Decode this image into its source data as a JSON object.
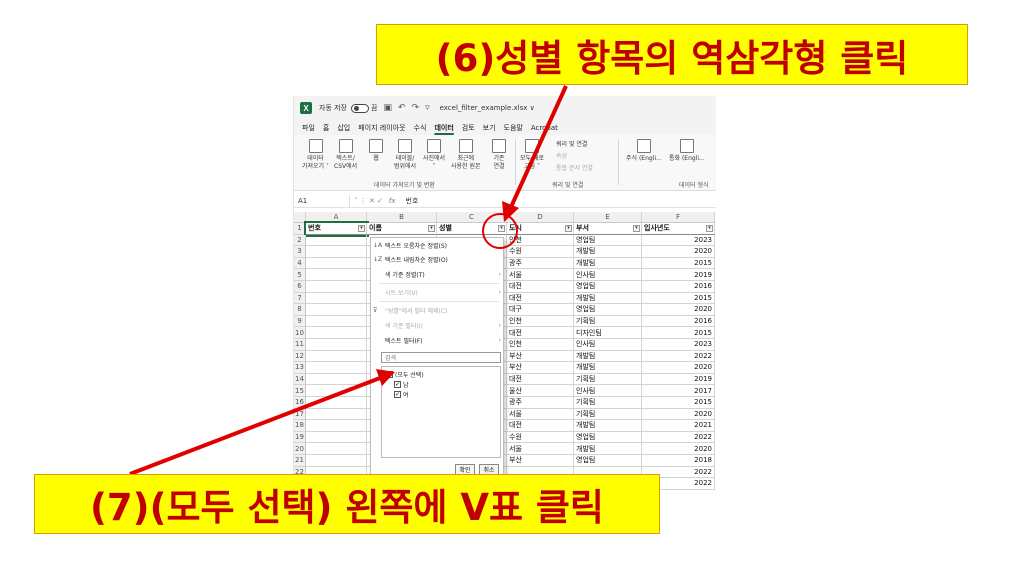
{
  "titlebar": {
    "logo": "X",
    "autosave_label": "자동 저장",
    "toggle_state": "끔",
    "file_name": "excel_filter_example.xlsx ∨"
  },
  "menu": [
    "파일",
    "홈",
    "삽입",
    "페이지 레이아웃",
    "수식",
    "데이터",
    "검토",
    "보기",
    "도움말",
    "Acrobat"
  ],
  "menu_active": "데이터",
  "ribbon": {
    "btn_data_get": "데이터\n가져오기 ˅",
    "btn_text_csv": "텍스트/\nCSV에서",
    "btn_web": "웹",
    "btn_table_range": "테이블/\n범위에서",
    "btn_from_picture": "사진에서\n˅",
    "btn_recent": "최근에\n사용한 원본",
    "btn_existing": "기존\n연결",
    "btn_refresh_all": "모두 새로\n고침 ˅",
    "group_get_transform": "데이터 가져오기 및 변환",
    "query_connections": "쿼리 및 연결",
    "properties": "속성",
    "edit_links": "통합 문서 연결",
    "group_queries": "쿼리 및 연결",
    "stocks": "주식 (Engli...",
    "currencies": "통화 (Engli...",
    "group_data_types": "데이터 형식"
  },
  "formula_bar": {
    "name_box": "A1",
    "controls": "˅ ⋮ ✕ ✓",
    "fx": "fx",
    "value": "번호"
  },
  "columns": [
    "A",
    "B",
    "C",
    "D",
    "E",
    "F"
  ],
  "headers": {
    "A": "번호",
    "B": "이름",
    "C": "성별",
    "D": "도시",
    "E": "부서",
    "F": "입사년도"
  },
  "rows": [
    {
      "city": "인천",
      "dept": "영업팀",
      "year": "2023"
    },
    {
      "city": "수원",
      "dept": "개발팀",
      "year": "2020"
    },
    {
      "city": "광주",
      "dept": "개발팀",
      "year": "2015"
    },
    {
      "city": "서울",
      "dept": "인사팀",
      "year": "2019"
    },
    {
      "city": "대전",
      "dept": "영업팀",
      "year": "2016"
    },
    {
      "city": "대전",
      "dept": "개발팀",
      "year": "2015"
    },
    {
      "city": "대구",
      "dept": "영업팀",
      "year": "2020"
    },
    {
      "city": "인천",
      "dept": "기획팀",
      "year": "2016"
    },
    {
      "city": "대전",
      "dept": "디자인팀",
      "year": "2015"
    },
    {
      "city": "인천",
      "dept": "인사팀",
      "year": "2023"
    },
    {
      "city": "부산",
      "dept": "개발팀",
      "year": "2022"
    },
    {
      "city": "부산",
      "dept": "개발팀",
      "year": "2020"
    },
    {
      "city": "대전",
      "dept": "기획팀",
      "year": "2019"
    },
    {
      "city": "울산",
      "dept": "인사팀",
      "year": "2017"
    },
    {
      "city": "광주",
      "dept": "기획팀",
      "year": "2015"
    },
    {
      "city": "서울",
      "dept": "기획팀",
      "year": "2020"
    },
    {
      "city": "대전",
      "dept": "개발팀",
      "year": "2021"
    },
    {
      "city": "수원",
      "dept": "영업팀",
      "year": "2022"
    },
    {
      "city": "서울",
      "dept": "개발팀",
      "year": "2020"
    },
    {
      "city": "부산",
      "dept": "영업팀",
      "year": "2018"
    },
    {
      "city": "",
      "dept": "",
      "year": "2022"
    },
    {
      "city": "",
      "dept": "",
      "year": "2022"
    }
  ],
  "filter_menu": {
    "sort_asc": "텍스트 오름차순 정렬(S)",
    "sort_desc": "텍스트 내림차순 정렬(O)",
    "sort_color": "색 기준 정렬(T)",
    "sheet_view": "시트 보기(V)",
    "clear_filter": "\"성별\"에서 필터 해제(C)",
    "filter_color": "색 기준 필터(I)",
    "text_filter": "텍스트 필터(F)",
    "search_placeholder": "검색",
    "select_all": "(모두 선택)",
    "option_male": "남",
    "option_female": "여",
    "ok": "확인",
    "cancel": "취소"
  },
  "callouts": {
    "step6": "(6)성별 항목의 역삼각형 클릭",
    "step7": "(7)(모두 선택) 왼쪽에 V표 클릭"
  },
  "colors": {
    "callout_bg": "#ffff00",
    "callout_text": "#c00000",
    "arrow": "#e00000",
    "excel_green": "#1d6f42"
  }
}
